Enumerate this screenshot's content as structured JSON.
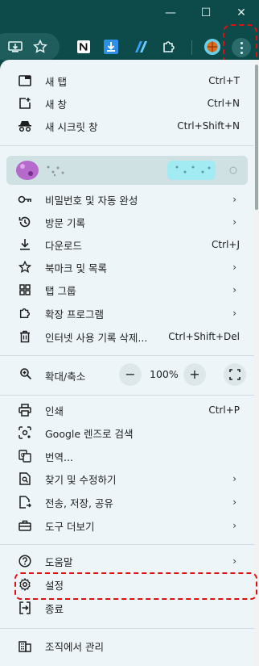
{
  "window": {
    "minimize": "—",
    "maximize": "☐",
    "close": "✕"
  },
  "toolbar": {
    "extensions": [
      "install-icon",
      "star-icon",
      "notion-icon",
      "download-icon",
      "perplexity-icon",
      "puzzle-icon",
      "profile-avatar",
      "menu-icon"
    ]
  },
  "menu": {
    "new_tab": {
      "label": "새 탭",
      "shortcut": "Ctrl+T"
    },
    "new_window": {
      "label": "새 창",
      "shortcut": "Ctrl+N"
    },
    "incognito": {
      "label": "새 시크릿 창",
      "shortcut": "Ctrl+Shift+N"
    },
    "passwords": {
      "label": "비밀번호 및 자동 완성"
    },
    "history": {
      "label": "방문 기록"
    },
    "downloads": {
      "label": "다운로드",
      "shortcut": "Ctrl+J"
    },
    "bookmarks": {
      "label": "북마크 및 목록"
    },
    "tab_groups": {
      "label": "탭 그룹"
    },
    "extensions": {
      "label": "확장 프로그램"
    },
    "clear_data": {
      "label": "인터넷 사용 기록 삭제...",
      "shortcut": "Ctrl+Shift+Del"
    },
    "zoom": {
      "label": "확대/축소",
      "minus": "−",
      "value": "100%",
      "plus": "+"
    },
    "print": {
      "label": "인쇄",
      "shortcut": "Ctrl+P"
    },
    "lens": {
      "label": "Google 렌즈로 검색"
    },
    "translate": {
      "label": "번역..."
    },
    "find_edit": {
      "label": "찾기 및 수정하기"
    },
    "cast_save_share": {
      "label": "전송, 저장, 공유"
    },
    "more_tools": {
      "label": "도구 더보기"
    },
    "help": {
      "label": "도움말"
    },
    "settings": {
      "label": "설정"
    },
    "exit": {
      "label": "종료"
    },
    "managed": {
      "label": "조직에서 관리"
    }
  },
  "arrow": "›"
}
